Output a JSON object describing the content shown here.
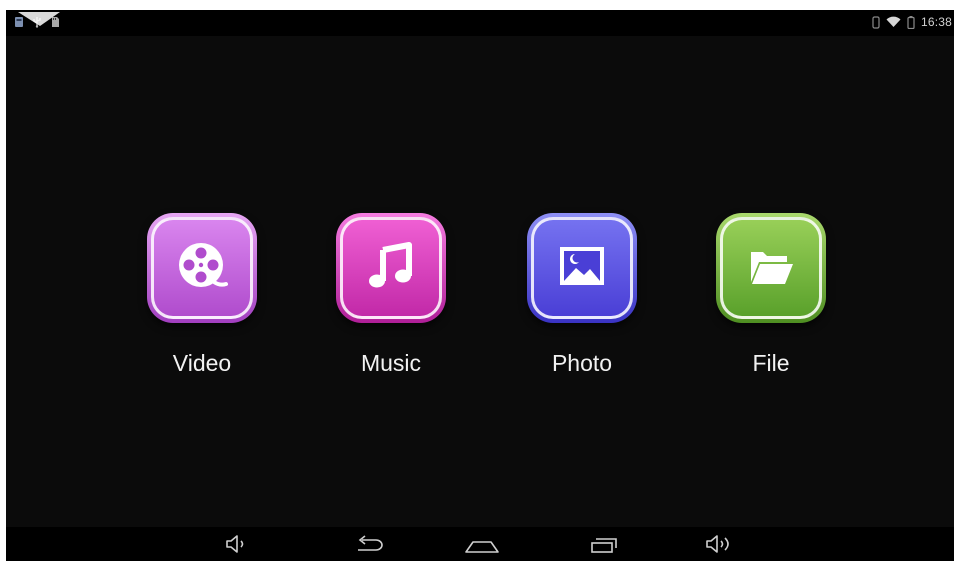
{
  "status_bar": {
    "time": "16:38",
    "left_icons": [
      "app-notification-icon",
      "usb-icon",
      "sd-card-icon"
    ],
    "right_icons": [
      "bluetooth-icon",
      "wifi-icon",
      "battery-icon"
    ]
  },
  "apps": [
    {
      "label": "Video",
      "icon": "film-reel-icon",
      "color": "#c25ad9"
    },
    {
      "label": "Music",
      "icon": "music-note-icon",
      "color": "#e03fc4"
    },
    {
      "label": "Photo",
      "icon": "picture-icon",
      "color": "#5a52e0"
    },
    {
      "label": "File",
      "icon": "folder-icon",
      "color": "#6fb13a"
    }
  ],
  "nav_bar": {
    "buttons": [
      "volume-down-icon",
      "back-icon",
      "home-icon",
      "recent-apps-icon",
      "volume-up-icon"
    ]
  },
  "colors": {
    "screen_background": "#0b0b0b",
    "bar_background": "#000000",
    "label_text": "#f2f2f2"
  }
}
